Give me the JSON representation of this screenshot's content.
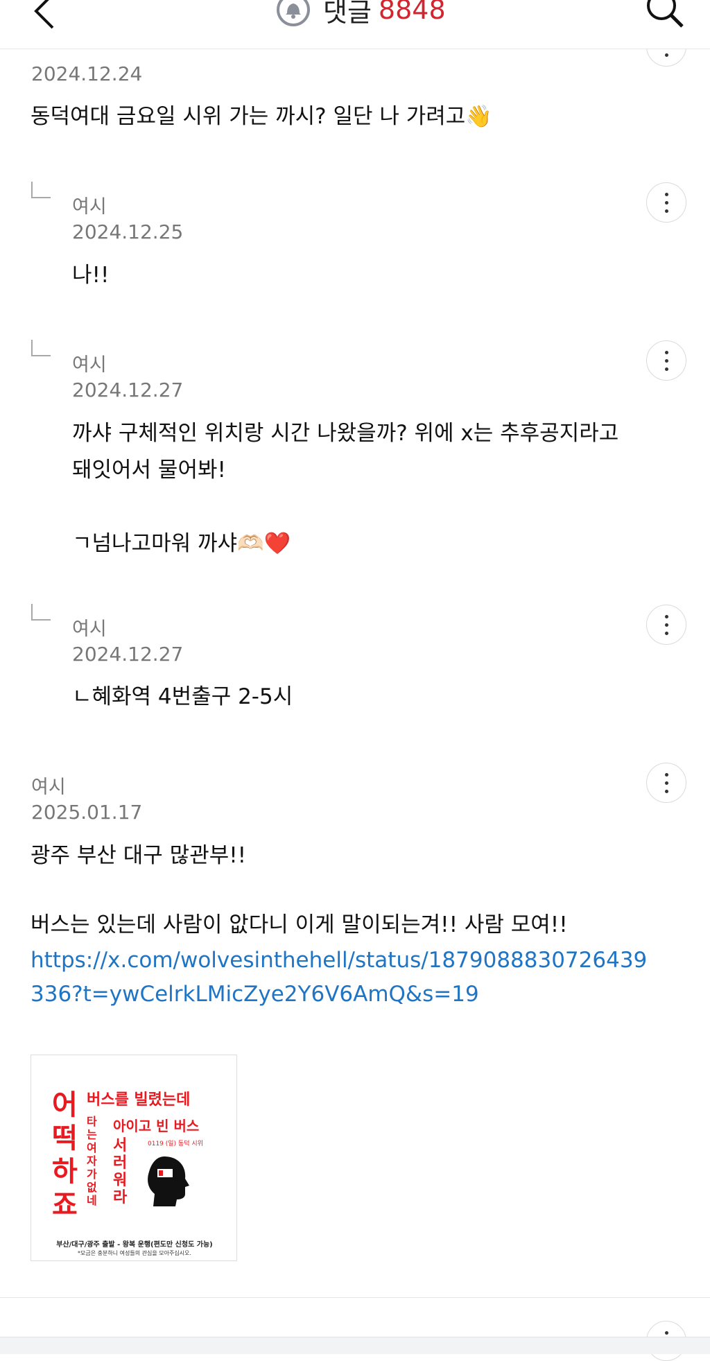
{
  "header": {
    "title": "댓글",
    "count": "8848",
    "back_icon": "back-arrow-icon",
    "bell_icon": "bell-icon",
    "search_icon": "search-icon"
  },
  "colors": {
    "accent": "#d1252f",
    "link": "#1f74c4"
  },
  "comments": [
    {
      "date": "2024.12.24",
      "body": "동덕여대 금요일 시위 가는 까시? 일단 나 가려고👋"
    },
    {
      "author": "여시",
      "date": "2024.12.25",
      "body": "나!!"
    },
    {
      "author": "여시",
      "date": "2024.12.27",
      "body": "까샤 구체적인 위치랑 시간 나왔을까? 위에 x는 추후공지라고\n돼잇어서 물어봐!\n\nㄱ넘나고마워 까샤🫶🏻❤️"
    },
    {
      "author": "여시",
      "date": "2024.12.27",
      "body": "ㄴ혜화역 4번출구 2-5시"
    },
    {
      "author": "여시",
      "date": "2025.01.17",
      "body": "광주 부산 대구 많관부!!\n\n버스는 있는데 사람이 앖다니 이게 말이되는겨!! 사람 모여!!",
      "link": "https://x.com/wolvesinthehell/status/1879088830726439336?t=ywCelrkLMicZye2Y6V6AmQ&s=19",
      "image": {
        "big": "어떡하죠",
        "line1": "버스를 빌렸는데",
        "line2": "타는 여자가 없네",
        "line3": "아이고 빈 버스",
        "line4": "0119 (일) 동덕 시위",
        "line5": "서러워라",
        "footer1": "부산/대구/광주 출발 - 왕복 운행(편도만 신청도 가능)",
        "footer2": "*모금은 충분하니 여성들의 관심을 모아주십시오."
      }
    }
  ]
}
